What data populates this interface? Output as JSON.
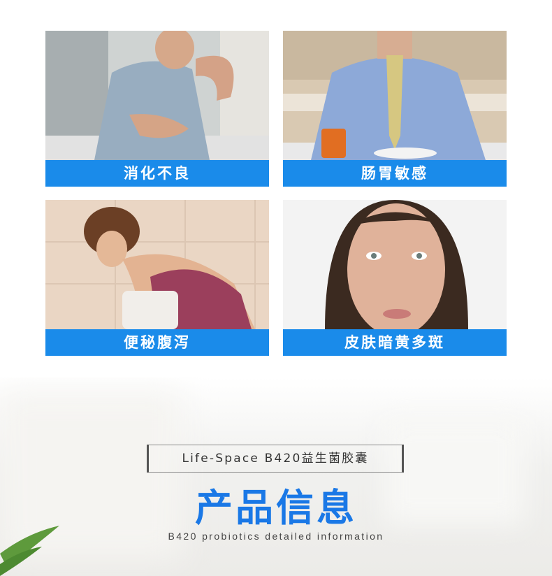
{
  "symptoms": [
    {
      "label": "消化不良",
      "image": "man-holding-stomach"
    },
    {
      "label": "肠胃敏感",
      "image": "man-in-shirt-tie-at-breakfast"
    },
    {
      "label": "便秘腹泻",
      "image": "woman-bending-over-toilet"
    },
    {
      "label": "皮肤暗黄多斑",
      "image": "woman-with-freckles-portrait"
    }
  ],
  "product": {
    "label": "Life-Space B420益生菌胶囊",
    "title": "产品信息",
    "subtitle": "B420 probiotics detailed information"
  },
  "colors": {
    "accent": "#1a8bea",
    "title": "#1a78e6"
  }
}
